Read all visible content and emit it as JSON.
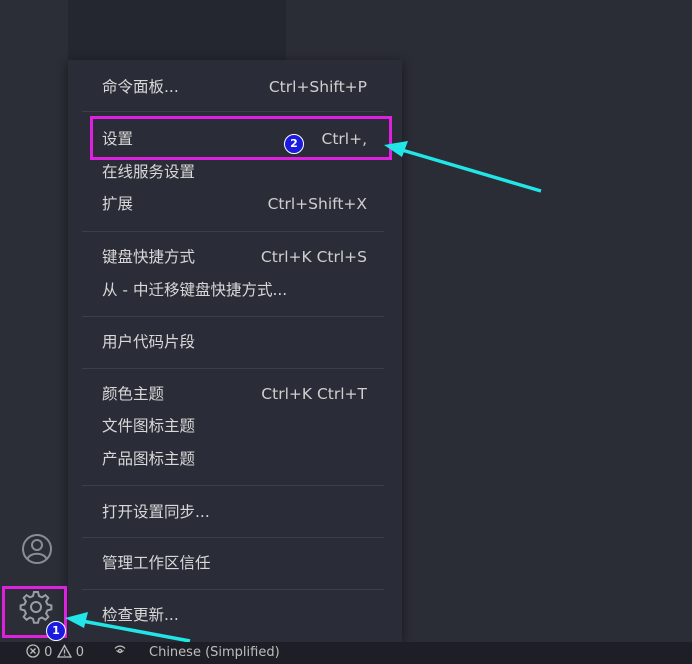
{
  "menu": {
    "items": [
      {
        "label": "命令面板...",
        "shortcut": "Ctrl+Shift+P"
      },
      {
        "label": "设置",
        "shortcut": "Ctrl+,"
      },
      {
        "label": "在线服务设置",
        "shortcut": ""
      },
      {
        "label": "扩展",
        "shortcut": "Ctrl+Shift+X"
      },
      {
        "label": "键盘快捷方式",
        "shortcut": "Ctrl+K Ctrl+S"
      },
      {
        "label": "从 - 中迁移键盘快捷方式...",
        "shortcut": ""
      },
      {
        "label": "用户代码片段",
        "shortcut": ""
      },
      {
        "label": "颜色主题",
        "shortcut": "Ctrl+K Ctrl+T"
      },
      {
        "label": "文件图标主题",
        "shortcut": ""
      },
      {
        "label": "产品图标主题",
        "shortcut": ""
      },
      {
        "label": "打开设置同步...",
        "shortcut": ""
      },
      {
        "label": "管理工作区信任",
        "shortcut": ""
      },
      {
        "label": "检查更新...",
        "shortcut": ""
      }
    ]
  },
  "annotations": {
    "badge1": "1",
    "badge2": "2",
    "highlight_color": "#e020e0",
    "arrow_color": "#22e5e8",
    "badge_color": "#1a1ae0"
  },
  "status_bar": {
    "errors_icon": "error-circle-icon",
    "errors": "0",
    "warnings_icon": "warning-triangle-icon",
    "warnings": "0",
    "broadcast_icon": "broadcast-icon",
    "language": "Chinese (Simplified)"
  },
  "activity_bar": {
    "icons": [
      "account-icon",
      "gear-icon"
    ]
  }
}
